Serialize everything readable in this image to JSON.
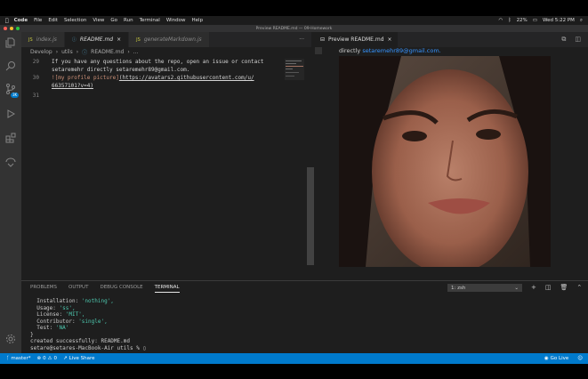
{
  "menubar": {
    "items": [
      "Code",
      "File",
      "Edit",
      "Selection",
      "View",
      "Go",
      "Run",
      "Terminal",
      "Window",
      "Help"
    ],
    "battery": "22%",
    "datetime": "Wed 5:22 PM"
  },
  "window": {
    "title": "Preview README.md — 09-Homework"
  },
  "activity": {
    "badge": "3K"
  },
  "editor": {
    "tabs": [
      {
        "label": "index.js",
        "type": "JS"
      },
      {
        "label": "README.md",
        "type": "MD"
      },
      {
        "label": "generateMarkdown.js",
        "type": "JS"
      }
    ],
    "more": "···",
    "breadcrumb": [
      "Develop",
      "utils",
      "README.md",
      "..."
    ],
    "lines": [
      {
        "num": "29",
        "text": "If you have any questions about the repo, open an issue or contact"
      },
      {
        "num": "",
        "text": "setaremehr directly setaremehr89@gmail.com."
      },
      {
        "num": "30",
        "link": "![my profile picture]",
        "url": "(https://avatars2.githubusercontent.com/u/"
      },
      {
        "num": "",
        "text": "66357101?v=4)"
      },
      {
        "num": "31",
        "text": ""
      }
    ]
  },
  "preview": {
    "tab_label": "Preview README.md",
    "text_prefix": "directly",
    "email": "setaremehr89@gmail.com."
  },
  "panel": {
    "tabs": [
      "PROBLEMS",
      "OUTPUT",
      "DEBUG CONSOLE",
      "TERMINAL"
    ],
    "shell": "1: zsh",
    "terminal": [
      {
        "k": "  Installation: ",
        "v": "'nothing',"
      },
      {
        "k": "  Usage: ",
        "v": "'ss',"
      },
      {
        "k": "  License: ",
        "v": "'MIT',"
      },
      {
        "k": "  Contributor: ",
        "v": "'single',"
      },
      {
        "k": "  Test: ",
        "v": "'NA'"
      },
      {
        "k": "}",
        "v": ""
      },
      {
        "k": "created successfully: README.md",
        "v": ""
      },
      {
        "k": "setare@setares-MacBook-Air utils % ",
        "v": ""
      }
    ]
  },
  "status": {
    "branch": "master*",
    "errors": "0",
    "warnings": "0",
    "liveshare": "Live Share",
    "golive": "Go Live"
  },
  "colors": {
    "accent": "#007acc",
    "link": "#3794ff",
    "string": "#4ec9b0"
  }
}
